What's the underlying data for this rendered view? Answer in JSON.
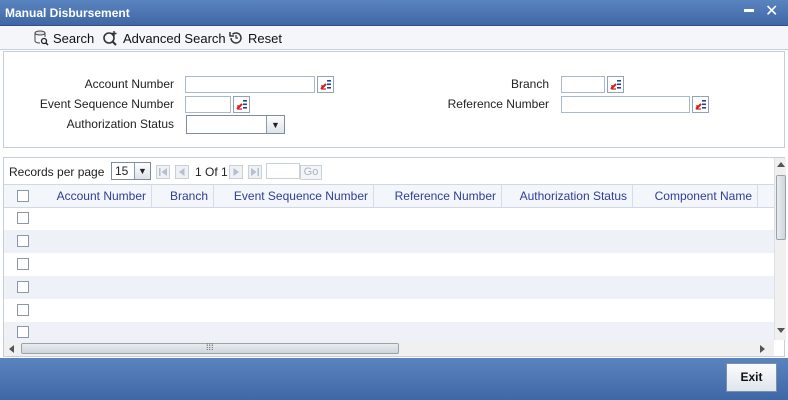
{
  "window": {
    "title": "Manual Disbursement",
    "minimize_glyph": "▬",
    "close_glyph": "✕"
  },
  "toolbar": {
    "search_label": "Search",
    "advanced_search_label": "Advanced Search",
    "reset_label": "Reset"
  },
  "form": {
    "account_number_label": "Account Number",
    "account_number_value": "",
    "branch_label": "Branch",
    "branch_value": "",
    "event_sequence_number_label": "Event Sequence Number",
    "event_sequence_number_value": "",
    "reference_number_label": "Reference Number",
    "reference_number_value": "",
    "authorization_status_label": "Authorization Status",
    "authorization_status_value": ""
  },
  "pager": {
    "records_per_page_label": "Records per page",
    "records_per_page_value": "15",
    "page_info": "1 Of 1",
    "go_label": "Go"
  },
  "grid": {
    "columns": [
      "Account Number",
      "Branch",
      "Event Sequence Number",
      "Reference Number",
      "Authorization Status",
      "Component Name"
    ],
    "row_count": 6
  },
  "footer": {
    "exit_label": "Exit"
  },
  "colors": {
    "title_bar": "#4a72b0",
    "header_text": "#2e3d9c",
    "alt_row": "#eef2f8"
  },
  "icons": [
    "search-icon",
    "advanced-search-icon",
    "reset-icon",
    "lov-icon",
    "first-page-icon",
    "prev-page-icon",
    "next-page-icon",
    "last-page-icon"
  ]
}
